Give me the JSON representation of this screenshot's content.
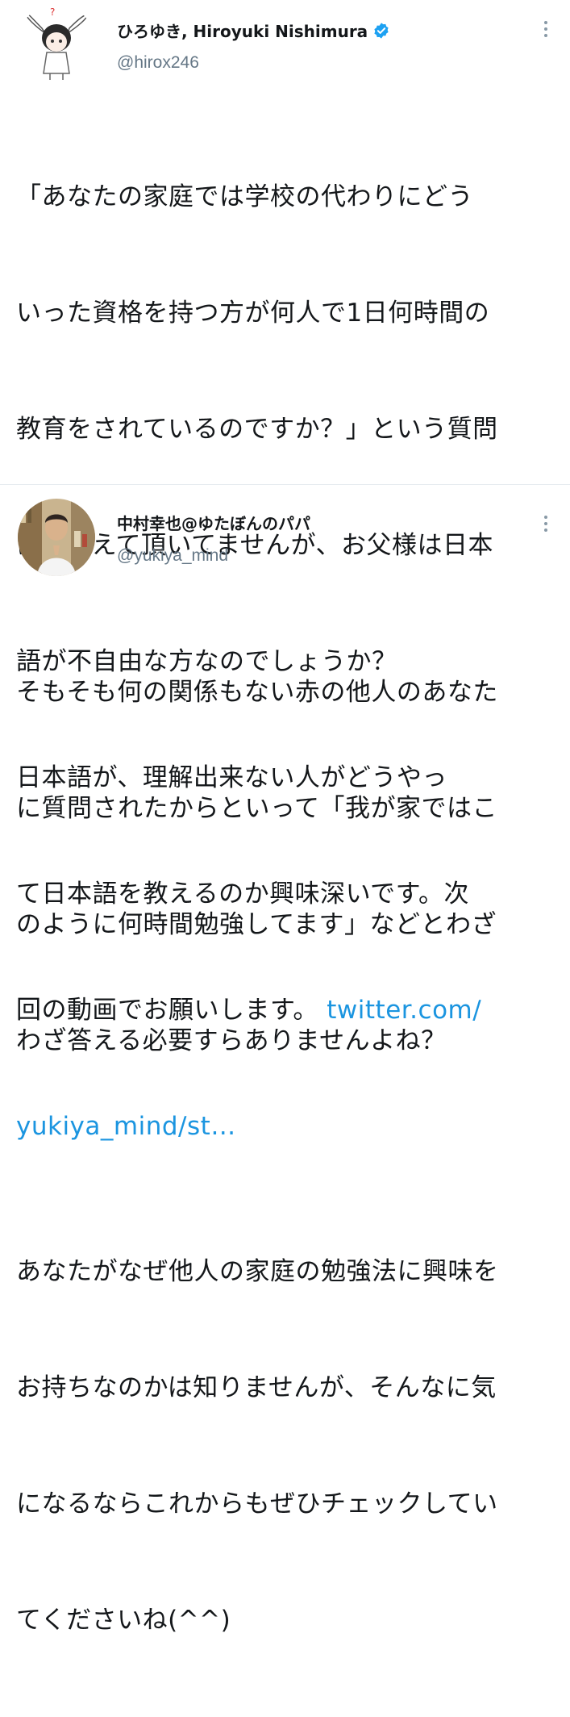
{
  "tweets": [
    {
      "author": {
        "display_name": "ひろゆき, Hiroyuki Nishimura",
        "handle": "@hirox246",
        "verified": true
      },
      "lines": [
        "「あなたの家庭では学校の代わりにどう",
        "いった資格を持つ方が何人で1日何時間の",
        "教育をされているのですか？」という質問",
        "に、答えて頂いてませんが、お父様は日本",
        "語が不自由な方なのでしょうか？",
        "日本語が、理解出来ない人がどうやっ",
        "て日本語を教えるのか興味深いです。次"
      ],
      "last_line_text": "回の動画でお願いします。 ",
      "link_part1": "twitter.com/",
      "link_part2": "yukiya_mind/st…"
    },
    {
      "author": {
        "display_name": "中村幸也@ゆたぼんのパパ",
        "handle": "@yukiya_mind",
        "verified": false
      },
      "paragraph1": [
        "そもそも何の関係もない赤の他人のあなた",
        "に質問されたからといって「我が家ではこ",
        "のように何時間勉強してます」などとわざ",
        "わざ答える必要すらありませんよね？"
      ],
      "paragraph2": [
        "あなたがなぜ他人の家庭の勉強法に興味を",
        "お持ちなのかは知りませんが、そんなに気",
        "になるならこれからもぜひチェックしてい",
        "てくださいね(^^)"
      ]
    }
  ],
  "colors": {
    "text": "#14171a",
    "secondary": "#657786",
    "link": "#1b95e0",
    "verified": "#1da1f2",
    "divider": "#e6ecf0"
  },
  "icons": {
    "verified": "verified-badge-icon",
    "menu": "chevron-down-icon"
  }
}
